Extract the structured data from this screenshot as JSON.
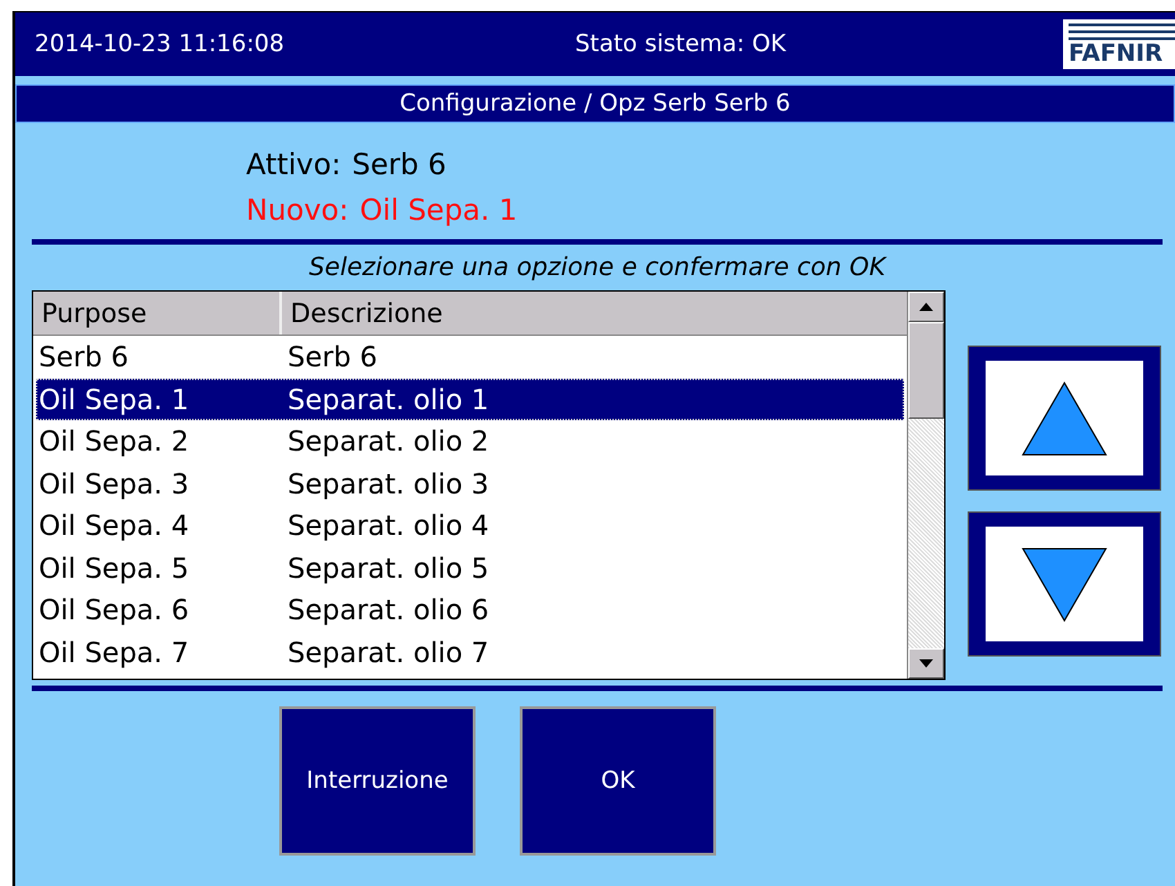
{
  "header": {
    "datetime": "2014-10-23  11:16:08",
    "status": "Stato sistema: OK",
    "logo": "FAFNIR"
  },
  "title": "Configurazione / Opz Serb Serb 6",
  "current": {
    "label": "Attivo:",
    "value": "Serb 6"
  },
  "new": {
    "label": "Nuovo:",
    "value": "Oil Sepa. 1"
  },
  "instruction": "Selezionare una opzione e confermare con OK",
  "table": {
    "columns": [
      "Purpose",
      "Descrizione"
    ],
    "rows": [
      {
        "cells": [
          "Serb 6",
          "Serb 6"
        ],
        "selected": false
      },
      {
        "cells": [
          "Oil Sepa. 1",
          "Separat. olio 1"
        ],
        "selected": true
      },
      {
        "cells": [
          "Oil Sepa. 2",
          "Separat. olio 2"
        ],
        "selected": false
      },
      {
        "cells": [
          "Oil Sepa. 3",
          "Separat. olio 3"
        ],
        "selected": false
      },
      {
        "cells": [
          "Oil Sepa. 4",
          "Separat. olio 4"
        ],
        "selected": false
      },
      {
        "cells": [
          "Oil Sepa. 5",
          "Separat. olio 5"
        ],
        "selected": false
      },
      {
        "cells": [
          "Oil Sepa. 6",
          "Separat. olio 6"
        ],
        "selected": false
      },
      {
        "cells": [
          "Oil Sepa. 7",
          "Separat. olio 7"
        ],
        "selected": false
      }
    ]
  },
  "buttons": [
    "Interruzione",
    "OK"
  ]
}
